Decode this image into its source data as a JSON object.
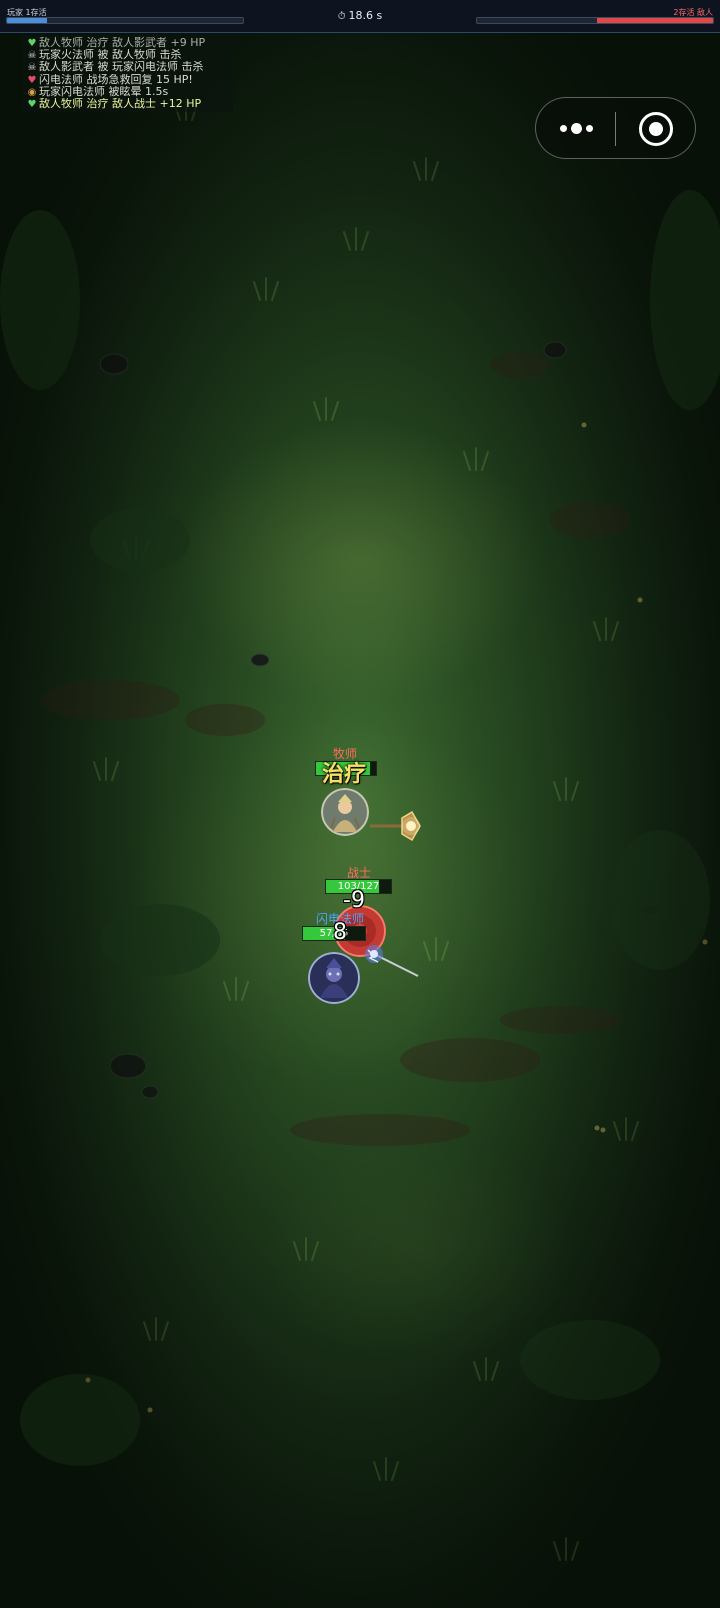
{
  "top_bar": {
    "player_label": "玩家 1存活",
    "enemy_label": "2存活 敌人",
    "player_progress": 0.17,
    "enemy_progress": 0.49,
    "timer_icon": "stopwatch-icon",
    "timer": "18.6 s"
  },
  "kill_feed": [
    {
      "icon": "heart-icon",
      "text": "敌人牧师 治疗 敌人影武者 +9 HP",
      "style": "fade"
    },
    {
      "icon": "crossed-skull-icon",
      "text": "玩家火法师 被 敌人牧师 击杀",
      "style": "normal"
    },
    {
      "icon": "crossed-skull-icon",
      "text": "敌人影武者 被 玩家闪电法师 击杀",
      "style": "normal"
    },
    {
      "icon": "heart-bandage-icon",
      "text": "闪电法师 战场急救回复 15 HP!",
      "style": "normal"
    },
    {
      "icon": "snail-icon",
      "text": "玩家闪电法师 被眩晕 1.5s",
      "style": "normal"
    },
    {
      "icon": "heart-icon",
      "text": "敌人牧师 治疗 敌人战士 +12 HP",
      "style": "bright"
    }
  ],
  "capsule": {
    "more_icon": "more-dots-icon",
    "close_icon": "target-circle-icon"
  },
  "units": {
    "priest": {
      "name": "牧师",
      "team": "enemy",
      "float_text": "治疗",
      "hp_fraction": 0.9
    },
    "warrior": {
      "name": "战士",
      "team": "enemy",
      "hp_text": "103/127",
      "hp_current": 103,
      "hp_max": 127,
      "damage_text": "-9"
    },
    "mage": {
      "name": "闪电法师",
      "team": "ally",
      "hp_text": "57/85",
      "hp_current": 57,
      "hp_max": 85,
      "damage_text": "8"
    }
  },
  "colors": {
    "ally": "#4aa6ff",
    "enemy": "#ff6e5a",
    "hp_bar": "#35c83d",
    "heal_text": "#f5e16a"
  }
}
